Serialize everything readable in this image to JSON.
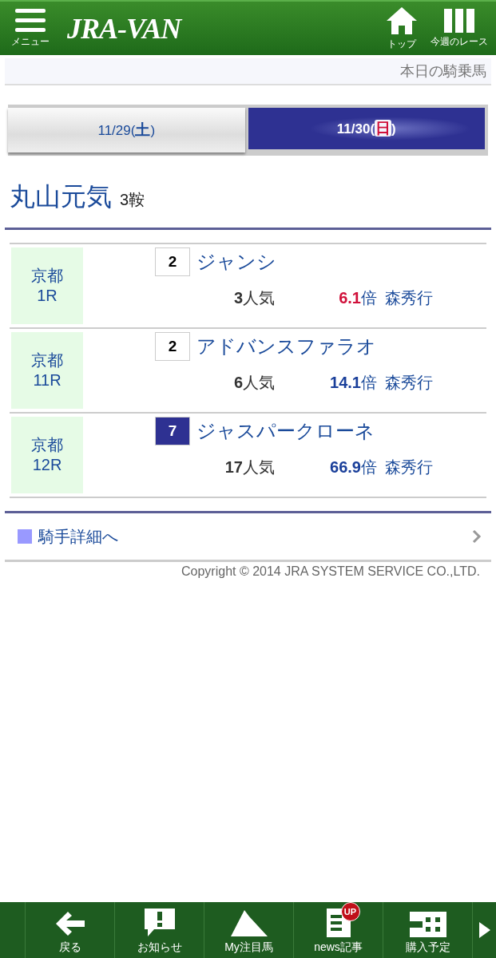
{
  "header": {
    "menu_label": "メニュー",
    "logo": "JRA-VAN",
    "nav": [
      {
        "kind": "home",
        "label": "トップ"
      },
      {
        "kind": "columns",
        "label": "今週のレース"
      }
    ]
  },
  "page_title": "本日の騎乗馬",
  "tabs": [
    {
      "date": "11/29(",
      "day": {
        "text": "土",
        "color": "#1a4a9a"
      },
      "close": ")",
      "selected": false
    },
    {
      "date": "11/30(",
      "day": {
        "text": "日",
        "color": "#d0103a"
      },
      "close": ")",
      "selected": true
    }
  ],
  "jockey": {
    "name": "丸山元気",
    "count": "3鞍"
  },
  "rides": [
    {
      "venue": "京都",
      "race": "1R",
      "frame": {
        "number": "2",
        "color": "#ffffff"
      },
      "horse": "ジャンシ",
      "popularity": {
        "value": "3",
        "unit": "人気"
      },
      "odds": {
        "value": "6.1",
        "unit": "倍",
        "color": "#d0103a"
      },
      "trainer": "森秀行"
    },
    {
      "venue": "京都",
      "race": "11R",
      "frame": {
        "number": "2",
        "color": "#ffffff"
      },
      "horse": "アドバンスファラオ",
      "popularity": {
        "value": "6",
        "unit": "人気"
      },
      "odds": {
        "value": "14.1",
        "unit": "倍",
        "color": "#1a3f9a"
      },
      "trainer": "森秀行"
    },
    {
      "venue": "京都",
      "race": "12R",
      "frame": {
        "number": "7",
        "color": "#2e3192"
      },
      "horse": "ジャスパークローネ",
      "popularity": {
        "value": "17",
        "unit": "人気"
      },
      "odds": {
        "value": "66.9",
        "unit": "倍",
        "color": "#1a3f9a"
      },
      "trainer": "森秀行"
    }
  ],
  "detail_link": "騎手詳細へ",
  "copyright": "Copyright © 2014 JRA SYSTEM SERVICE CO.,LTD.",
  "bottom_nav": [
    {
      "kind": "back",
      "label": "戻る"
    },
    {
      "kind": "notice",
      "label": "お知らせ"
    },
    {
      "kind": "horse",
      "label": "My注目馬"
    },
    {
      "kind": "news",
      "label": "news記事",
      "badge": "UP"
    },
    {
      "kind": "plan",
      "label": "購入予定"
    }
  ]
}
